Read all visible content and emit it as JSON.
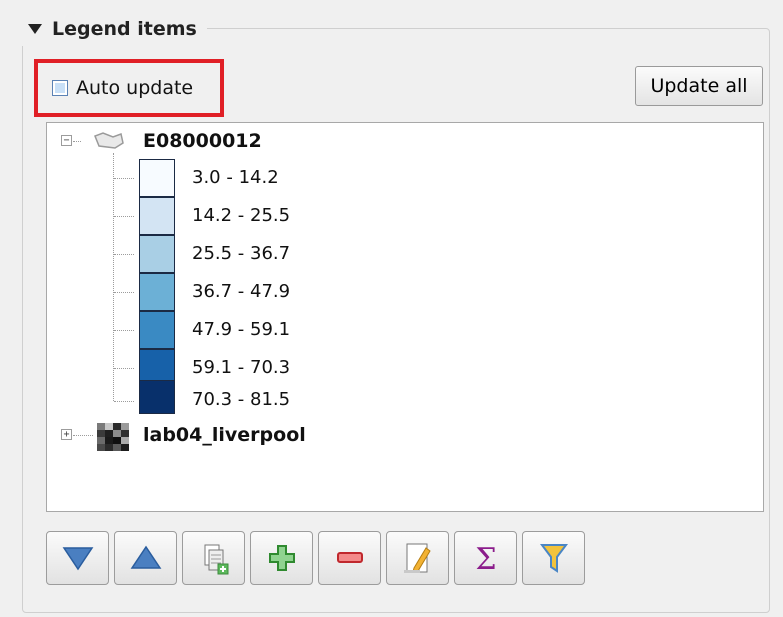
{
  "group": {
    "title": "Legend items",
    "collapsed": false
  },
  "auto_update": {
    "label": "Auto update",
    "checked": false
  },
  "update_all_label": "Update all",
  "tree": {
    "layers": [
      {
        "name": "E08000012",
        "icon": "polygon-layer-icon",
        "expanded": true,
        "classes": [
          {
            "label": "3.0 - 14.2",
            "color": "#f7fbff"
          },
          {
            "label": "14.2 - 25.5",
            "color": "#d3e4f3"
          },
          {
            "label": "25.5 - 36.7",
            "color": "#a9cfe5"
          },
          {
            "label": "36.7 - 47.9",
            "color": "#6cb0d6"
          },
          {
            "label": "47.9 - 59.1",
            "color": "#3a8ac3"
          },
          {
            "label": "59.1 - 70.3",
            "color": "#1761a9"
          },
          {
            "label": "70.3 - 81.5",
            "color": "#08306b"
          }
        ]
      },
      {
        "name": "lab04_liverpool",
        "icon": "raster-layer-icon",
        "expanded": false
      }
    ]
  },
  "toolbar": {
    "buttons": [
      {
        "name": "move-down-button",
        "icon": "triangle-down-icon"
      },
      {
        "name": "move-up-button",
        "icon": "triangle-up-icon"
      },
      {
        "name": "add-group-button",
        "icon": "add-group-icon"
      },
      {
        "name": "add-item-button",
        "icon": "plus-icon"
      },
      {
        "name": "remove-item-button",
        "icon": "minus-icon"
      },
      {
        "name": "edit-item-button",
        "icon": "edit-icon"
      },
      {
        "name": "count-features-button",
        "icon": "sigma-icon"
      },
      {
        "name": "filter-legend-button",
        "icon": "filter-icon"
      }
    ]
  },
  "colors": {
    "highlight_border": "#e01f26"
  }
}
